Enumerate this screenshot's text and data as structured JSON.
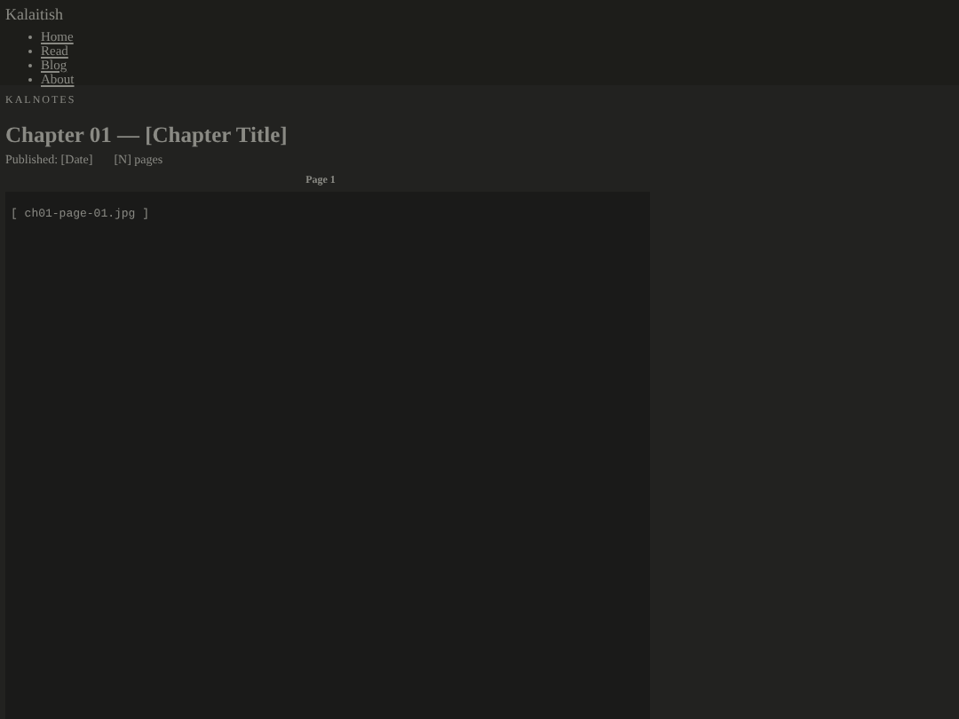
{
  "site": {
    "title": "Kalaitish"
  },
  "nav": [
    {
      "label": "Home"
    },
    {
      "label": "Read"
    },
    {
      "label": "Blog"
    },
    {
      "label": "About"
    }
  ],
  "article": {
    "eyebrow": "KALNOTES",
    "title": "Chapter 01 — [Chapter Title]",
    "published": "Published: [Date]",
    "pages": "[N] pages",
    "page_label": "Page 1",
    "image_caption": "[ ch01-page-01.jpg ]"
  }
}
